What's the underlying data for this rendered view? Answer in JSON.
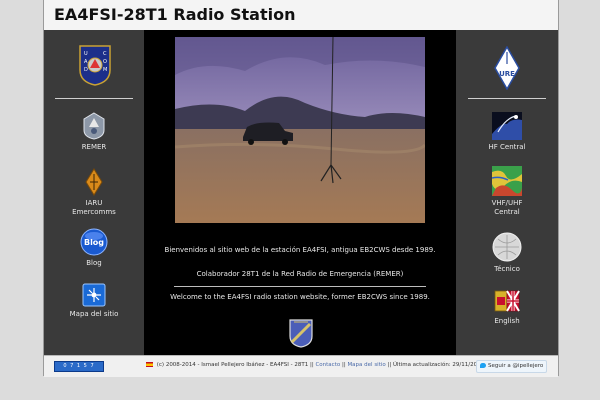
{
  "site_title": "EA4FSI-28T1 Radio Station",
  "left_nav": [
    {
      "label": "REMER",
      "icon": "remer-shield-icon"
    },
    {
      "label": "IARU\nEmercomms",
      "icon": "iaru-diamond-icon"
    },
    {
      "label": "Blog",
      "icon": "blog-bubble-icon",
      "badge": "Blog"
    },
    {
      "label": "Mapa del sitio",
      "icon": "sitemap-icon"
    }
  ],
  "uad_logo": {
    "top": "U A D",
    "bottom": "C O M"
  },
  "right_nav": [
    {
      "label": "HF Central",
      "icon": "hf-spectrum-icon"
    },
    {
      "label": "VHF/UHF\nCentral",
      "icon": "terrain-map-icon"
    },
    {
      "label": "Técnico",
      "icon": "technical-disc-icon"
    },
    {
      "label": "English",
      "icon": "uk-flag-book-icon"
    }
  ],
  "ure_logo": "URE",
  "welcome_es": "Bienvenidos al sitio web de la estación EA4FSI, antigua EB2CWS desde 1989.",
  "collab_es": "Colaborador 28T1 de la Red Radio de Emergencia (REMER)",
  "welcome_en": "Welcome to the EA4FSI radio station website, former EB2CWS since 1989.",
  "footer": {
    "copyright": "(c) 2008-2014 - Ismael Pellejero Ibáñez - EA4FSI - 28T1 ||",
    "contact": "Contacto",
    "sep1": "||",
    "sitemap": "Mapa del sitio",
    "updated": "|| Última actualización: 29/11/2014.",
    "follow": "Seguir a @ipellejero",
    "counter": "0 7 1 5 7"
  },
  "colors": {
    "frame": "#2a2a2a",
    "column": "#3a3a3a",
    "center": "#000000",
    "twitter": "#1da1f2"
  }
}
